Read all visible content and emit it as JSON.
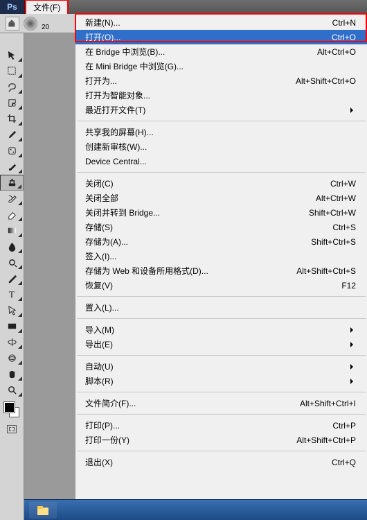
{
  "app": {
    "badge": "Ps"
  },
  "menubar": {
    "file_label": "文件(F)"
  },
  "options_bar": {
    "size_value": "20"
  },
  "tools": [
    {
      "name": "move",
      "interact": true
    },
    {
      "name": "marquee",
      "interact": true
    },
    {
      "name": "lasso",
      "interact": true
    },
    {
      "name": "quick-select",
      "interact": true
    },
    {
      "name": "crop",
      "interact": true
    },
    {
      "name": "eyedropper",
      "interact": true
    },
    {
      "name": "healing-brush",
      "interact": true
    },
    {
      "name": "brush",
      "interact": true
    },
    {
      "name": "clone-stamp",
      "interact": true,
      "active": true
    },
    {
      "name": "history-brush",
      "interact": true
    },
    {
      "name": "eraser",
      "interact": true
    },
    {
      "name": "gradient",
      "interact": true
    },
    {
      "name": "blur",
      "interact": true
    },
    {
      "name": "dodge",
      "interact": true
    },
    {
      "name": "pen",
      "interact": true
    },
    {
      "name": "type",
      "interact": true
    },
    {
      "name": "path-select",
      "interact": true
    },
    {
      "name": "rectangle",
      "interact": true
    },
    {
      "name": "3d-rotate",
      "interact": true
    },
    {
      "name": "3d-orbit",
      "interact": true
    },
    {
      "name": "hand",
      "interact": true
    },
    {
      "name": "zoom",
      "interact": true
    }
  ],
  "menu": {
    "groups": [
      [
        {
          "label": "新建(N)...",
          "shortcut": "Ctrl+N"
        },
        {
          "label": "打开(O)...",
          "shortcut": "Ctrl+O",
          "highlight": true
        },
        {
          "label": "在 Bridge 中浏览(B)...",
          "shortcut": "Alt+Ctrl+O"
        },
        {
          "label": "在 Mini Bridge 中浏览(G)..."
        },
        {
          "label": "打开为...",
          "shortcut": "Alt+Shift+Ctrl+O"
        },
        {
          "label": "打开为智能对象..."
        },
        {
          "label": "最近打开文件(T)",
          "submenu": true
        }
      ],
      [
        {
          "label": "共享我的屏幕(H)..."
        },
        {
          "label": "创建新审核(W)..."
        },
        {
          "label": "Device Central..."
        }
      ],
      [
        {
          "label": "关闭(C)",
          "shortcut": "Ctrl+W"
        },
        {
          "label": "关闭全部",
          "shortcut": "Alt+Ctrl+W"
        },
        {
          "label": "关闭并转到 Bridge...",
          "shortcut": "Shift+Ctrl+W"
        },
        {
          "label": "存储(S)",
          "shortcut": "Ctrl+S"
        },
        {
          "label": "存储为(A)...",
          "shortcut": "Shift+Ctrl+S"
        },
        {
          "label": "签入(I)..."
        },
        {
          "label": "存储为 Web 和设备所用格式(D)...",
          "shortcut": "Alt+Shift+Ctrl+S"
        },
        {
          "label": "恢复(V)",
          "shortcut": "F12"
        }
      ],
      [
        {
          "label": "置入(L)..."
        }
      ],
      [
        {
          "label": "导入(M)",
          "submenu": true
        },
        {
          "label": "导出(E)",
          "submenu": true
        }
      ],
      [
        {
          "label": "自动(U)",
          "submenu": true
        },
        {
          "label": "脚本(R)",
          "submenu": true
        }
      ],
      [
        {
          "label": "文件简介(F)...",
          "shortcut": "Alt+Shift+Ctrl+I"
        }
      ],
      [
        {
          "label": "打印(P)...",
          "shortcut": "Ctrl+P"
        },
        {
          "label": "打印一份(Y)",
          "shortcut": "Alt+Shift+Ctrl+P"
        }
      ],
      [
        {
          "label": "退出(X)",
          "shortcut": "Ctrl+Q"
        }
      ]
    ]
  }
}
